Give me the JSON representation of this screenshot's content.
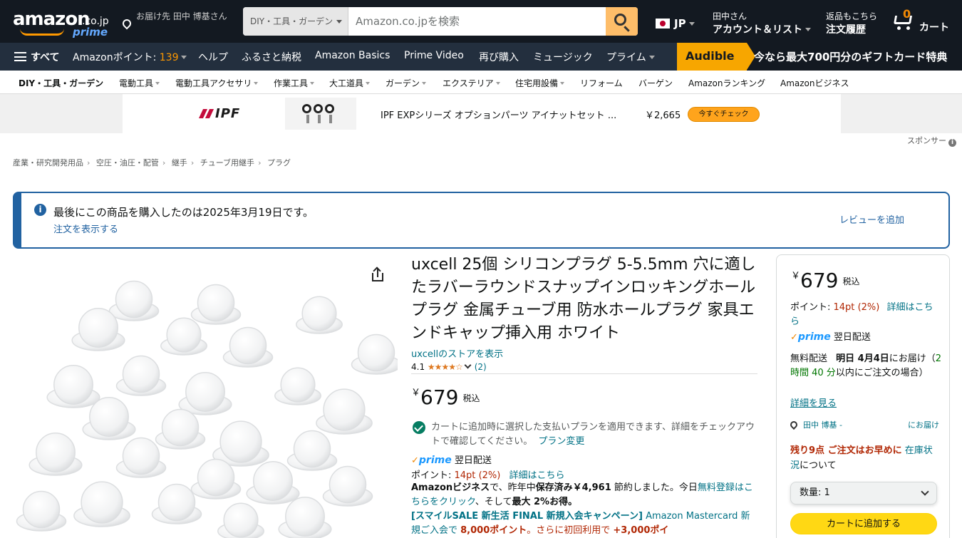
{
  "header": {
    "logo_text": "amazon",
    "logo_tld": ".co.jp",
    "logo_prime": "prime",
    "deliver_to": "お届け先 田中 博基さん",
    "search_category": "DIY・工具・ガーデン",
    "search_placeholder": "Amazon.co.jpを検索",
    "locale": "JP",
    "account_line1": "田中さん",
    "account_line2": "アカウント＆リスト",
    "orders_line1": "返品もこちら",
    "orders_line2": "注文履歴",
    "cart_count": "0",
    "cart_label": "カート"
  },
  "main_nav": {
    "all": "すべて",
    "points_label": "Amazonポイント: ",
    "points_value": "139",
    "items": [
      "ヘルプ",
      "ふるさと納税",
      "Amazon Basics",
      "Prime Video",
      "再び購入",
      "ミュージック",
      "プライム"
    ],
    "audible_label": "Audible",
    "audible_promo": "今なら最大700円分のギフトカード特典"
  },
  "sub_nav": {
    "category": "DIY・工具・ガーデン",
    "items": [
      "電動工具",
      "電動工具アクセサリ",
      "作業工具",
      "大工道具",
      "ガーデン",
      "エクステリア",
      "住宅用設備",
      "リフォーム",
      "バーゲン",
      "Amazonランキング",
      "Amazonビジネス"
    ]
  },
  "ad": {
    "brand": "IPF",
    "title": "IPF EXPシリーズ オプションパーツ アイナットセット ...",
    "price": "￥2,665",
    "cta": "今すぐチェック",
    "sponsor": "スポンサー"
  },
  "breadcrumb": [
    "産業・研究開発用品",
    "空圧・油圧・配管",
    "継手",
    "チューブ用継手",
    "プラグ"
  ],
  "notice": {
    "text": "最後にこの商品を購入したのは2025年3月19日です。",
    "view_order": "注文を表示する",
    "add_review": "レビューを追加"
  },
  "product": {
    "title": "uxcell 25個 シリコンプラグ 5-5.5mm 穴に適したラバーラウンドスナップインロッキングホールプラグ 金属チューブ用 防水ホールプラグ 家具エンドキャップ挿入用 ホワイト",
    "store_link": "uxcellのストアを表示",
    "rating_value": "4.1",
    "rating": 4.1,
    "review_count": "(2)",
    "currency": "￥",
    "price": "679",
    "tax": "税込",
    "plan_text": "カートに追加時に選択した支払いプランを適用できます、詳細をチェックアウトで確認してください。",
    "plan_link": "プラン変更",
    "prime": "prime",
    "delivery_speed": "翌日配送",
    "points_label": "ポイント: ",
    "points_value": "14pt",
    "points_pct": "(2%)",
    "points_link": "詳細はこちら",
    "biz_a": "Amazonビジネス",
    "biz_b": "で、昨年中",
    "biz_c": "保存済み￥4,961",
    "biz_d": " 節約しました。今日",
    "biz_link": "無料登録はこちらをクリック",
    "biz_e": "、そして",
    "biz_f": "最大 2%お得。",
    "sale_a": "[スマイルSALE 新生活 FINAL 新規入会キャンペーン]",
    "sale_b": " Amazon Mastercard 新規ご入会で ",
    "sale_c": "8,000ポイント",
    "sale_d": "。さらに初回利用で ",
    "sale_e": "+3,000ポイ"
  },
  "buybox": {
    "currency": "￥",
    "price": "679",
    "tax": "税込",
    "points_label": "ポイント: ",
    "points_value": "14pt",
    "points_pct": "(2%)",
    "points_link": "詳細はこちら",
    "prime": "prime",
    "delivery_speed": "翌日配送",
    "ship_a": "無料配送",
    "ship_b": "明日 4月4日",
    "ship_c": "にお届け（",
    "ship_d": "2 時間 40 分",
    "ship_e": "以内にご注文の場合）",
    "detail_link": "詳細を見る",
    "addr_name": "田中 博基 -",
    "addr_right": "にお届け",
    "stock_warn": "残り9点 ご注文はお早めに",
    "stock_link": "在庫状況",
    "stock_tail": "について",
    "qty_label": "数量: 1",
    "add_to_cart": "カートに追加する"
  },
  "colors": {
    "nav_bg": "#131921",
    "nav_secondary": "#232f3e",
    "accent_orange": "#ff9900",
    "link_teal": "#007185",
    "price_red": "#b12704",
    "cart_button": "#ffd814",
    "notice_blue": "#2162a1"
  }
}
